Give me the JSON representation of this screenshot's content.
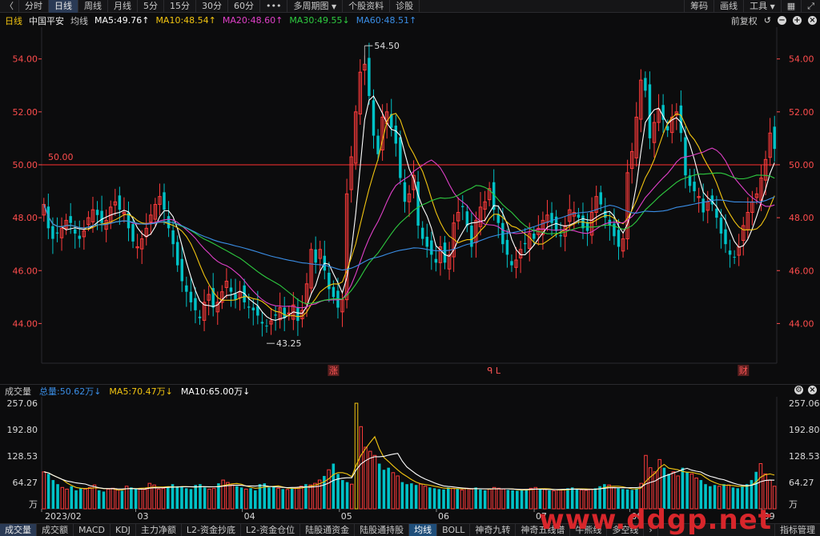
{
  "toolbar": {
    "back_glyph": "〈",
    "periods": [
      "分时",
      "日线",
      "周线",
      "月线",
      "5分",
      "15分",
      "30分",
      "60分"
    ],
    "more_glyph": "•••",
    "multi_period": "多周期图",
    "stock_info": "个股资料",
    "diagnosis": "诊股",
    "right": [
      "筹码",
      "画线",
      "工具"
    ],
    "dropdown_glyph": "▼",
    "grid_icon": "▦",
    "fullscreen_icon": "⤢"
  },
  "ma_header": {
    "period": "日线",
    "stock": "中国平安",
    "label": "均线",
    "ma5": "MA5:49.76↑",
    "ma10": "MA10:48.54↑",
    "ma20": "MA20:48.60↑",
    "ma30": "MA30:49.55↓",
    "ma60": "MA60:48.51↑",
    "adjust": "前复权",
    "colors": {
      "ma5": "#ffffff",
      "ma10": "#f2c511",
      "ma20": "#e040c8",
      "ma30": "#2ecc40",
      "ma60": "#3a8ee6"
    }
  },
  "volume_header": {
    "label": "成交量",
    "total": "总量:50.62万↓",
    "ma5": "MA5:70.47万↓",
    "ma10": "MA10:65.00万↓"
  },
  "bottom_tabs": [
    "成交量",
    "成交额",
    "MACD",
    "KDJ",
    "主力净额",
    "L2-资金抄底",
    "L2-资金仓位",
    "陆股通资金",
    "陆股通持股",
    "均线",
    "BOLL",
    "神奇九转",
    "神奇五线谱",
    "牛熊线",
    "多空线",
    "指标管理"
  ],
  "watermark": "www.ddgp.net",
  "colors": {
    "up": "#ff3b3b",
    "down": "#00c2c7",
    "bg": "#0c0c0d",
    "grid": "#2a2a2e",
    "axis": "#ff4d4d",
    "ref": "#ff2f2f"
  },
  "chart_data": [
    {
      "type": "candlestick",
      "title": "中国平安 日线",
      "x_labels": [
        "2023/02",
        "03",
        "04",
        "05",
        "06",
        "07",
        "08",
        "09"
      ],
      "ylim": [
        42.5,
        55.2
      ],
      "yticks": [
        "44.00",
        "46.00",
        "48.00",
        "50.00",
        "52.00",
        "54.00"
      ],
      "ytick_values": [
        44,
        46,
        48,
        50,
        52,
        54
      ],
      "reference_line": {
        "value": 50.0,
        "label": "50.00"
      },
      "annotations": {
        "high": "54.50",
        "low": "43.25"
      },
      "markers": [
        "涨",
        "ᑫ L",
        "财"
      ],
      "close": [
        48.5,
        47.6,
        47.2,
        47.4,
        47.6,
        47.9,
        47.8,
        47.4,
        47.2,
        47.5,
        48.0,
        48.3,
        48.1,
        47.8,
        47.9,
        48.4,
        48.6,
        48.3,
        48.2,
        47.6,
        47.1,
        46.9,
        47.2,
        47.6,
        48.1,
        48.5,
        48.8,
        48.3,
        47.6,
        47.0,
        46.2,
        45.6,
        45.2,
        44.8,
        44.5,
        44.2,
        44.8,
        45.1,
        44.6,
        44.8,
        45.2,
        45.6,
        45.2,
        44.9,
        45.2,
        44.8,
        44.6,
        44.5,
        44.3,
        44.0,
        43.9,
        44.1,
        44.3,
        44.6,
        44.2,
        44.4,
        44.7,
        44.1,
        44.5,
        45.5,
        46.8,
        46.3,
        46.8,
        46.0,
        45.3,
        45.0,
        44.6,
        44.9,
        48.9,
        50.3,
        52.0,
        53.5,
        53.8,
        52.6,
        51.1,
        50.4,
        51.8,
        52.0,
        51.4,
        50.8,
        49.5,
        48.6,
        48.9,
        49.6,
        47.7,
        47.2,
        46.9,
        46.6,
        46.3,
        46.9,
        46.3,
        46.6,
        47.8,
        48.2,
        48.4,
        47.7,
        46.9,
        47.9,
        48.4,
        48.6,
        49.1,
        48.3,
        47.8,
        47.0,
        46.6,
        46.2,
        46.4,
        46.8,
        47.0,
        47.4,
        47.2,
        47.6,
        47.9,
        48.1,
        47.8,
        47.5,
        47.3,
        47.7,
        48.3,
        48.2,
        48.0,
        47.6,
        47.5,
        48.2,
        48.8,
        48.5,
        48.0,
        47.7,
        47.3,
        46.9,
        47.2,
        49.7,
        50.5,
        51.8,
        53.2,
        52.8,
        51.0,
        51.6,
        52.1,
        51.7,
        51.3,
        51.8,
        52.0,
        51.2,
        49.6,
        49.2,
        49.0,
        48.8,
        48.2,
        48.6,
        48.5,
        48.0,
        47.4,
        47.0,
        46.6,
        46.5,
        46.9,
        47.7,
        48.2,
        48.6,
        48.9,
        49.5,
        50.2,
        51.2,
        50.6
      ],
      "series": [
        {
          "name": "MA5",
          "color": "#ffffff",
          "window": 5
        },
        {
          "name": "MA10",
          "color": "#f2c511",
          "window": 10
        },
        {
          "name": "MA20",
          "color": "#e040c8",
          "window": 20
        },
        {
          "name": "MA30",
          "color": "#2ecc40",
          "window": 30
        },
        {
          "name": "MA60",
          "color": "#3a8ee6",
          "window": 60
        }
      ]
    },
    {
      "type": "bar",
      "title": "成交量",
      "ylim": [
        0,
        257.06
      ],
      "yticks": [
        "64.27",
        "128.53",
        "192.80",
        "257.06"
      ],
      "ytick_values": [
        64.27,
        128.53,
        192.8,
        257.06
      ],
      "unit_label": "万",
      "values": [
        90,
        85,
        70,
        60,
        52,
        48,
        55,
        45,
        50,
        48,
        52,
        58,
        45,
        42,
        48,
        50,
        46,
        44,
        55,
        52,
        48,
        50,
        47,
        62,
        58,
        48,
        50,
        52,
        60,
        55,
        54,
        50,
        48,
        58,
        60,
        52,
        48,
        50,
        62,
        70,
        64,
        58,
        55,
        52,
        48,
        50,
        45,
        60,
        62,
        52,
        55,
        50,
        48,
        47,
        50,
        52,
        55,
        60,
        58,
        62,
        70,
        80,
        95,
        110,
        85,
        70,
        65,
        60,
        257,
        200,
        150,
        140,
        130,
        110,
        95,
        100,
        88,
        80,
        65,
        60,
        62,
        58,
        60,
        55,
        52,
        50,
        48,
        47,
        52,
        50,
        48,
        46,
        50,
        48,
        52,
        47,
        45,
        48,
        52,
        50,
        48,
        46,
        45,
        44,
        46,
        48,
        50,
        52,
        48,
        47,
        45,
        44,
        46,
        47,
        50,
        52,
        48,
        46,
        45,
        48,
        50,
        55,
        60,
        58,
        52,
        50,
        48,
        47,
        46,
        50,
        62,
        130,
        100,
        90,
        120,
        100,
        85,
        90,
        80,
        100,
        90,
        85,
        75,
        70,
        60,
        55,
        58,
        55,
        60,
        58,
        52,
        50,
        55,
        60,
        70,
        90,
        110,
        85,
        70,
        55
      ]
    }
  ]
}
